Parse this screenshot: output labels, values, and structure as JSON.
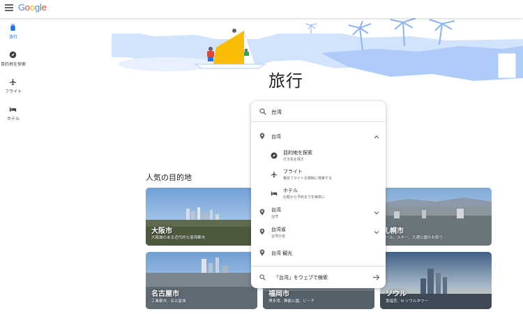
{
  "header": {
    "logo_text": "Google",
    "menu_icon": "hamburger-menu-icon"
  },
  "sidebar": {
    "items": [
      {
        "label": "旅行",
        "icon": "luggage-icon",
        "active": true
      },
      {
        "label": "目的地を探索",
        "icon": "compass-icon",
        "active": false
      },
      {
        "label": "フライト",
        "icon": "airplane-icon",
        "active": false
      },
      {
        "label": "ホテル",
        "icon": "bed-icon",
        "active": false
      }
    ]
  },
  "page_title": "旅行",
  "popular_section_title": "人気の目的地",
  "destinations": [
    {
      "name": "大阪市",
      "desc": "大阪城のある近代的な港湾都市"
    },
    {
      "name": "札幌市",
      "desc": "ビール、スキー、大通公園のお祭り"
    },
    {
      "name": "名古屋市",
      "desc": "工業都市、名古屋城"
    },
    {
      "name": "福岡市",
      "desc": "博多湾、舞鶴公園、ビーチ"
    },
    {
      "name": "ソウル",
      "desc": "景福宮、N ソウルタワー"
    }
  ],
  "search": {
    "value": "台湾",
    "suggestions": [
      {
        "main": "台湾",
        "sub": "",
        "expanded": true
      },
      {
        "main": "台湾",
        "sub": "台湾",
        "expanded": false
      },
      {
        "main": "台湾省",
        "sub": "台湾の省",
        "expanded": false
      },
      {
        "main": "台湾 観光",
        "sub": "",
        "expanded": null
      }
    ],
    "sub_options": [
      {
        "main": "目的地を探索",
        "sub": "行き先を探す",
        "icon": "compass-icon"
      },
      {
        "main": "フライト",
        "sub": "格安フライトを瞬時に検索する",
        "icon": "airplane-icon"
      },
      {
        "main": "ホテル",
        "sub": "比較から予約までを簡単に",
        "icon": "bed-icon"
      }
    ],
    "web_search_label": "「台湾」をウェブで検索"
  },
  "colors": {
    "accent": "#1a73e8",
    "hero_blue": "#aecbfa",
    "text": "#202124",
    "secondary": "#5f6368"
  }
}
